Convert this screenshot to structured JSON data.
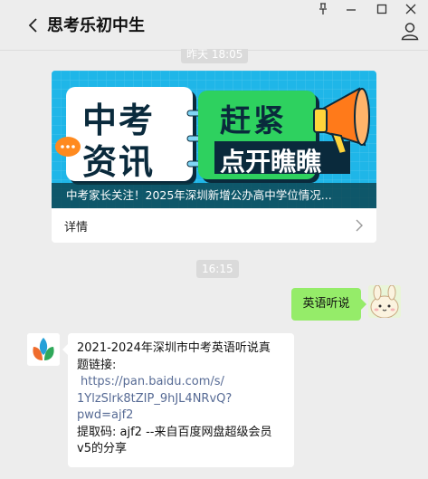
{
  "titlebar": {
    "title": "思考乐初中生",
    "controls": [
      "pin-icon",
      "minimize-icon",
      "maximize-icon",
      "close-icon"
    ]
  },
  "timestamps": {
    "first": "昨天 18:05",
    "second": "16:15"
  },
  "article": {
    "banner": {
      "left_line1": "中考",
      "left_line2": "资讯",
      "right_line1": "赶紧",
      "right_line2": "点开瞧瞧",
      "colors": {
        "background": "#1fb6e8",
        "panel": "#2ed15f",
        "accent": "#ff7a1a"
      }
    },
    "caption": "中考家长关注！2025年深圳新增公办高中学位情况...",
    "details_label": "详情"
  },
  "messages": {
    "outgoing": {
      "text": "英语听说"
    },
    "incoming": {
      "line1": "2021-2024年深圳市中考英语听说真",
      "line2": "题链接:",
      "link1": "https://pan.baidu.com/s/",
      "link2": "1YlzSlrk8tZIP_9hJL4NRvQ?",
      "link3": "pwd=ajf2",
      "line3": "提取码: ajf2 --来自百度网盘超级会员",
      "line4": "v5的分享"
    }
  },
  "colors": {
    "chat_background": "#ededed",
    "outgoing_bubble": "#95ec69",
    "link": "#576b95"
  }
}
